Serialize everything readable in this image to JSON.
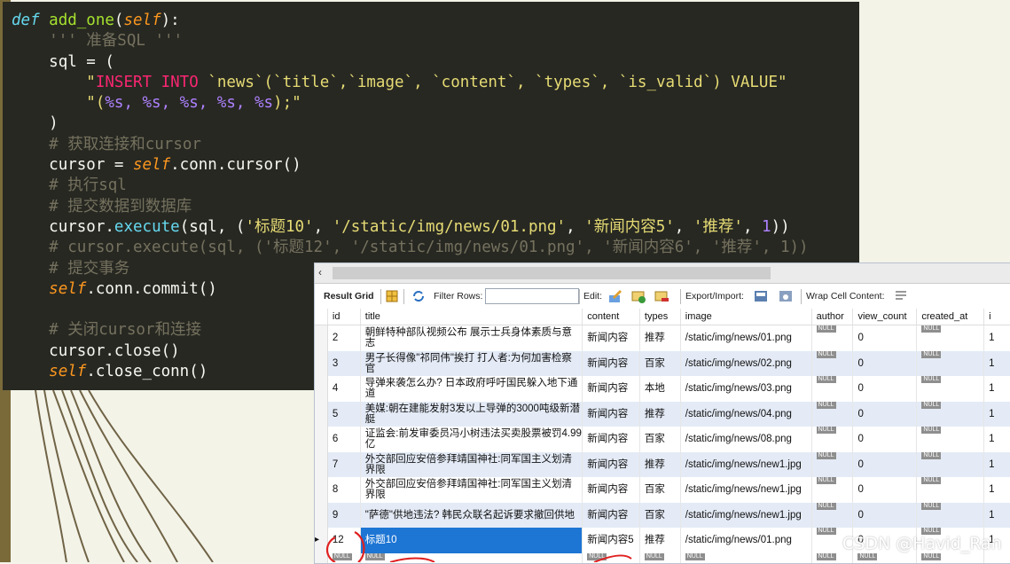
{
  "code": {
    "line1": {
      "def": "def",
      "fname": "add_one",
      "open": "(",
      "self": "self",
      "close": "):"
    },
    "docstring": "''' 准备SQL '''",
    "sql_assign": "sql = (",
    "sql_str1_q": "\"",
    "sql_str1_kw": "INSERT INTO",
    "sql_str1_rest": " `news`(`title`,`image`, `content`, `types`, `is_valid`) VALUE\"",
    "sql_str2_open": "\"(",
    "sql_str2_fmt": "%s, %s, %s, %s, %s",
    "sql_str2_close": ");\"",
    "paren_close": ")",
    "comment1": "# 获取连接和cursor",
    "cursor_assign_left": "cursor = ",
    "cursor_assign_self": "self",
    "cursor_assign_right": ".conn.cursor()",
    "comment2": "# 执行sql",
    "comment3": "# 提交数据到数据库",
    "exec_prefix": "cursor.",
    "exec_method": "execute",
    "exec_args_a": "(sql, (",
    "exec_s1": "'标题10'",
    "exec_s2": "'/static/img/news/01.png'",
    "exec_s3": "'新闻内容5'",
    "exec_s4": "'推荐'",
    "exec_num": "1",
    "exec_end": "))",
    "comment4": "# cursor.execute(sql, ('标题12', '/static/img/news/01.png', '新闻内容6', '推荐', 1))",
    "comment5": "# 提交事务",
    "commit_self": "self",
    "commit_rest": ".conn.commit()",
    "comment6": "# 关闭cursor和连接",
    "close_cursor": "cursor.close()",
    "close_self": "self",
    "close_rest": ".close_conn()"
  },
  "toolbar": {
    "result_grid": "Result Grid",
    "filter_rows": "Filter Rows:",
    "filter_value": "",
    "edit": "Edit:",
    "export_import": "Export/Import:",
    "wrap_cell": "Wrap Cell Content:"
  },
  "grid": {
    "columns": [
      "id",
      "title",
      "content",
      "types",
      "image",
      "author",
      "view_count",
      "created_at"
    ],
    "null_label": "NULL",
    "rows": [
      {
        "id": "2",
        "title": "朝鲜特种部队视频公布 展示士兵身体素质与意志",
        "content": "新闻内容",
        "types": "推荐",
        "image": "/static/img/news/01.png",
        "view_count": "0"
      },
      {
        "id": "3",
        "title": "男子长得像\"祁同伟\"挨打 打人者:为何加害检察官",
        "content": "新闻内容",
        "types": "百家",
        "image": "/static/img/news/02.png",
        "view_count": "0"
      },
      {
        "id": "4",
        "title": "导弹来袭怎么办? 日本政府呼吁国民躲入地下通道",
        "content": "新闻内容",
        "types": "本地",
        "image": "/static/img/news/03.png",
        "view_count": "0"
      },
      {
        "id": "5",
        "title": "美媒:朝在建能发射3发以上导弹的3000吨级新潜艇",
        "content": "新闻内容",
        "types": "推荐",
        "image": "/static/img/news/04.png",
        "view_count": "0"
      },
      {
        "id": "6",
        "title": "证监会:前发审委员冯小树违法买卖股票被罚4.99亿",
        "content": "新闻内容",
        "types": "百家",
        "image": "/static/img/news/08.png",
        "view_count": "0"
      },
      {
        "id": "7",
        "title": "外交部回应安倍参拜靖国神社:同军国主义划清界限",
        "content": "新闻内容",
        "types": "推荐",
        "image": "/static/img/news/new1.jpg",
        "view_count": "0"
      },
      {
        "id": "8",
        "title": "外交部回应安倍参拜靖国神社:同军国主义划清界限",
        "content": "新闻内容",
        "types": "百家",
        "image": "/static/img/news/new1.jpg",
        "view_count": "0"
      },
      {
        "id": "9",
        "title": "\"萨德\"供地违法? 韩民众联名起诉要求撤回供地",
        "content": "新闻内容",
        "types": "百家",
        "image": "/static/img/news/new1.jpg",
        "view_count": "0"
      },
      {
        "id": "12",
        "title": "标题10",
        "content": "新闻内容5",
        "types": "推荐",
        "image": "/static/img/news/01.png",
        "view_count": "0"
      }
    ]
  },
  "watermark": "CSDN @Havid_Ran",
  "colors": {
    "annotation_red": "#e02020",
    "selected_cell": "#1d75d4",
    "editor_bg": "#272822"
  }
}
